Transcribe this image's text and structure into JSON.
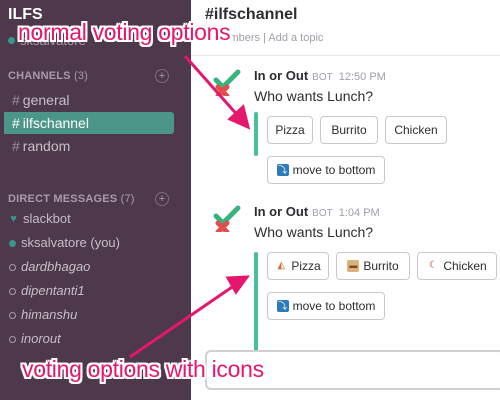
{
  "sidebar": {
    "team_name": "ILFS",
    "current_user": "sksalvatore",
    "channels_header": "CHANNELS",
    "channels_count": "(3)",
    "channels": [
      {
        "label": "general"
      },
      {
        "label": "ilfschannel"
      },
      {
        "label": "random"
      }
    ],
    "active_channel_index": 1,
    "dm_header": "DIRECT MESSAGES",
    "dm_count": "(7)",
    "direct_messages": [
      {
        "label": "slackbot",
        "status": "heart"
      },
      {
        "label": "sksalvatore (you)",
        "status": "online"
      },
      {
        "label": "dardbhagao",
        "status": "away"
      },
      {
        "label": "dipentanti1",
        "status": "away"
      },
      {
        "label": "himanshu",
        "status": "away"
      },
      {
        "label": "inorout",
        "status": "away"
      }
    ]
  },
  "channel_header": {
    "title": "#ilfschannel",
    "meta": "4 members  |  Add a topic"
  },
  "messages": [
    {
      "author": "In or Out",
      "badge": "BOT",
      "time": "12:50 PM",
      "text": "Who wants Lunch?",
      "buttons": [
        "Pizza",
        "Burrito",
        "Chicken"
      ],
      "move_button": "move to bottom"
    },
    {
      "author": "In or Out",
      "badge": "BOT",
      "time": "1:04 PM",
      "text": "Who wants Lunch?",
      "buttons": [
        "Pizza",
        "Burrito",
        "Chicken"
      ],
      "button_icons": [
        "pizza-icon",
        "burrito-icon",
        "chicken-icon"
      ],
      "move_button": "move to bottom"
    }
  ],
  "annotations": {
    "top": "normal voting options",
    "bottom": "voting options with icons"
  },
  "colors": {
    "sidebar_bg": "#4d394b",
    "active_channel": "#4c9689",
    "attachment_bar": "#4bbf9d",
    "annotation": "#e5176d"
  }
}
